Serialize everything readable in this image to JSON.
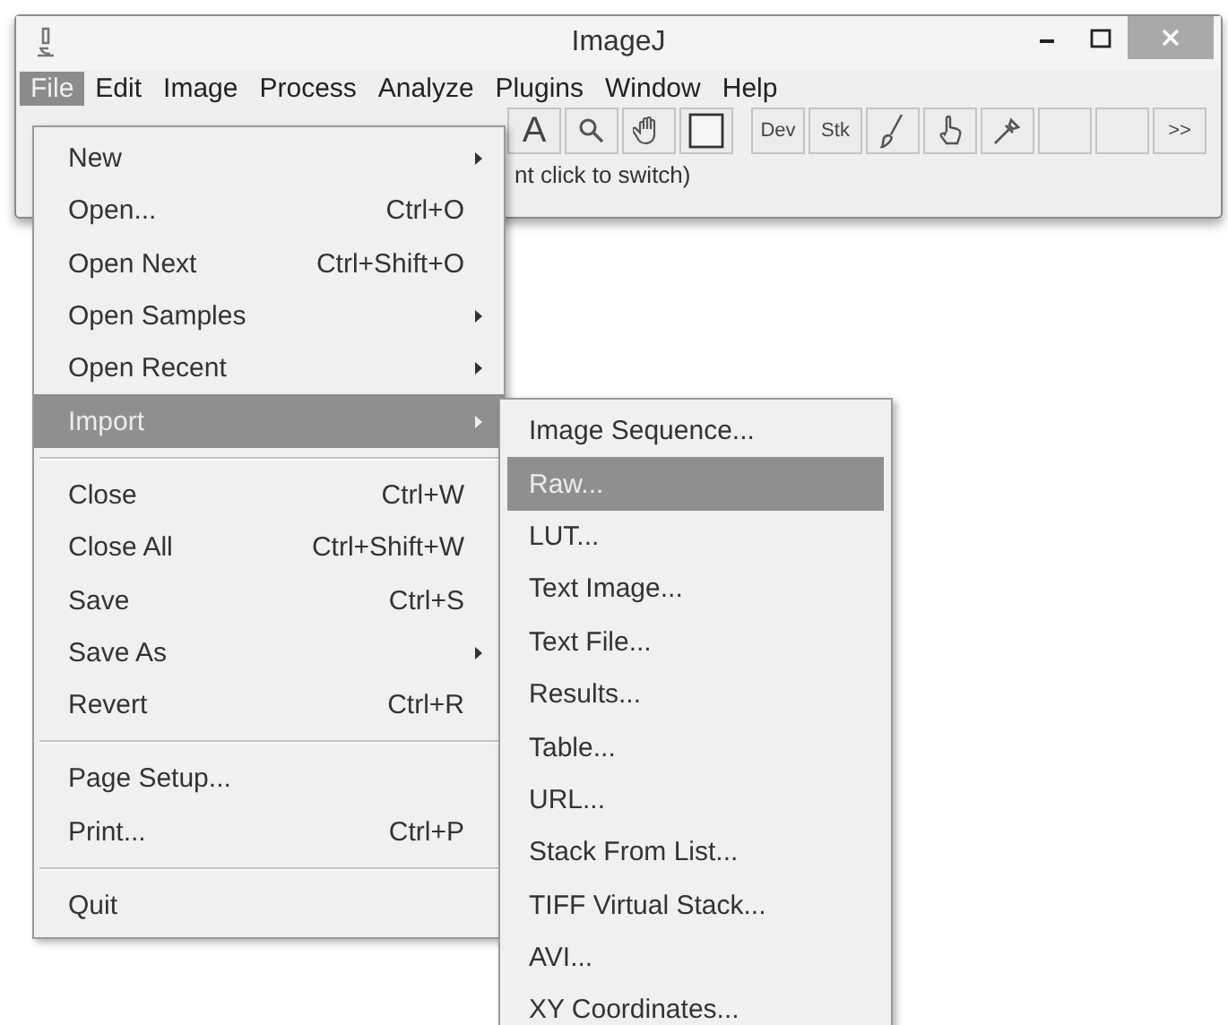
{
  "window": {
    "title": "ImageJ"
  },
  "menubar": [
    {
      "label": "File",
      "selected": true
    },
    {
      "label": "Edit",
      "selected": false
    },
    {
      "label": "Image",
      "selected": false
    },
    {
      "label": "Process",
      "selected": false
    },
    {
      "label": "Analyze",
      "selected": false
    },
    {
      "label": "Plugins",
      "selected": false
    },
    {
      "label": "Window",
      "selected": false
    },
    {
      "label": "Help",
      "selected": false
    }
  ],
  "toolbar": {
    "text_tool": "A",
    "dev": "Dev",
    "stk": "Stk",
    "more": ">>"
  },
  "status": "nt click to switch)",
  "file_menu": [
    {
      "kind": "item",
      "label": "New",
      "submenu": true,
      "selected": false
    },
    {
      "kind": "item",
      "label": "Open...",
      "shortcut": "Ctrl+O",
      "submenu": false,
      "selected": false
    },
    {
      "kind": "item",
      "label": "Open Next",
      "shortcut": "Ctrl+Shift+O",
      "submenu": false,
      "selected": false
    },
    {
      "kind": "item",
      "label": "Open Samples",
      "submenu": true,
      "selected": false
    },
    {
      "kind": "item",
      "label": "Open Recent",
      "submenu": true,
      "selected": false
    },
    {
      "kind": "item",
      "label": "Import",
      "submenu": true,
      "selected": true
    },
    {
      "kind": "separator"
    },
    {
      "kind": "item",
      "label": "Close",
      "shortcut": "Ctrl+W",
      "submenu": false,
      "selected": false
    },
    {
      "kind": "item",
      "label": "Close All",
      "shortcut": "Ctrl+Shift+W",
      "submenu": false,
      "selected": false
    },
    {
      "kind": "item",
      "label": "Save",
      "shortcut": "Ctrl+S",
      "submenu": false,
      "selected": false
    },
    {
      "kind": "item",
      "label": "Save As",
      "submenu": true,
      "selected": false
    },
    {
      "kind": "item",
      "label": "Revert",
      "shortcut": "Ctrl+R",
      "submenu": false,
      "selected": false
    },
    {
      "kind": "separator"
    },
    {
      "kind": "item",
      "label": "Page Setup...",
      "submenu": false,
      "selected": false
    },
    {
      "kind": "item",
      "label": "Print...",
      "shortcut": "Ctrl+P",
      "submenu": false,
      "selected": false
    },
    {
      "kind": "separator"
    },
    {
      "kind": "item",
      "label": "Quit",
      "submenu": false,
      "selected": false
    }
  ],
  "import_menu": [
    {
      "label": "Image Sequence...",
      "selected": false
    },
    {
      "label": "Raw...",
      "selected": true
    },
    {
      "label": "LUT...",
      "selected": false
    },
    {
      "label": "Text Image...",
      "selected": false
    },
    {
      "label": "Text File...",
      "selected": false
    },
    {
      "label": "Results...",
      "selected": false
    },
    {
      "label": "Table...",
      "selected": false
    },
    {
      "label": "URL...",
      "selected": false
    },
    {
      "label": "Stack From List...",
      "selected": false
    },
    {
      "label": "TIFF Virtual Stack...",
      "selected": false
    },
    {
      "label": "AVI...",
      "selected": false
    },
    {
      "label": "XY Coordinates...",
      "selected": false
    }
  ]
}
